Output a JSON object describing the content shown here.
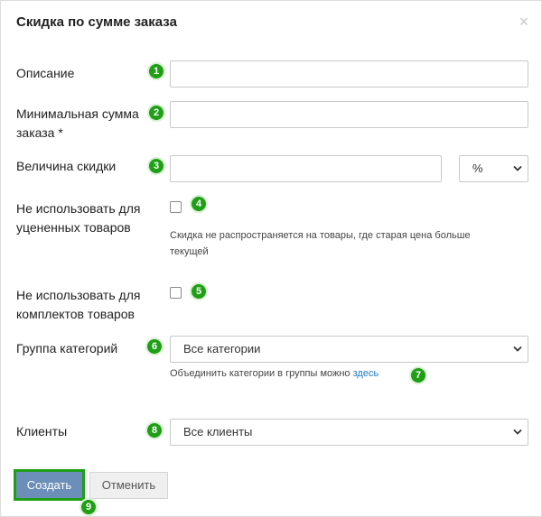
{
  "dialog": {
    "title": "Скидка по сумме заказа",
    "close_glyph": "×"
  },
  "fields": {
    "description": {
      "label": "Описание",
      "value": ""
    },
    "min_sum": {
      "label_line1": "Минимальная сумма",
      "label_line2": "заказа *",
      "value": ""
    },
    "discount": {
      "label": "Величина скидки",
      "value": "",
      "unit": "%"
    },
    "exclude_discounted": {
      "label_line1": "Не использовать для",
      "label_line2": "уцененных товаров",
      "checked": false,
      "hint_line1": "Скидка не распространяется на товары, где старая цена больше",
      "hint_line2": "текущей"
    },
    "exclude_bundles": {
      "label_line1": "Не использовать для",
      "label_line2": "комплектов товаров",
      "checked": false
    },
    "category_group": {
      "label": "Группа категорий",
      "selected": "Все категории",
      "hint_text": "Объединить категории в группы можно",
      "hint_link": "здесь"
    },
    "clients": {
      "label": "Клиенты",
      "selected": "Все клиенты"
    }
  },
  "buttons": {
    "create": "Создать",
    "cancel": "Отменить"
  },
  "badges": [
    "1",
    "2",
    "3",
    "4",
    "5",
    "6",
    "7",
    "8",
    "9"
  ],
  "colors": {
    "badge": "#1f9e16",
    "primary_button": "#6b8fb8",
    "link": "#1e7bc1"
  }
}
